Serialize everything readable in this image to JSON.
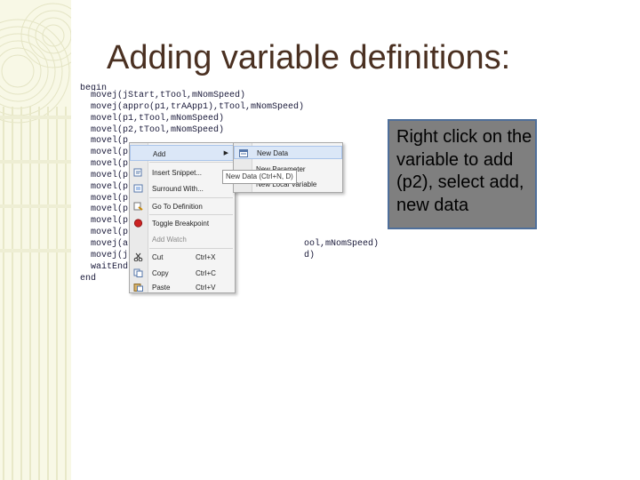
{
  "slide": {
    "title": "Adding variable definitions:",
    "callout_text": "Right click on the variable to add (p2), select add, new data"
  },
  "code": {
    "lines": [
      "begin",
      "  movej(jStart,tTool,mNomSpeed)",
      "  movej(appro(p1,trAApp1),tTool,mNomSpeed)",
      "  movel(p1,tTool,mNomSpeed)",
      "  movel(p2,tTool,mNomSpeed)",
      "  movel(p",
      "  movel(p",
      "  movel(p",
      "  movel(p",
      "  movel(p",
      "  movel(p",
      "  movel(p",
      "  movel(p",
      "  movel(p",
      "  movej(a                                 ool,mNomSpeed)",
      "  movej(j                                 d)",
      "  waitEnd",
      "end"
    ]
  },
  "context_menu": {
    "items": [
      {
        "label": "Add",
        "icon": "none",
        "shortcut": "",
        "submenu": true
      },
      {
        "label": "Insert Snippet...",
        "icon": "snippet-icon",
        "shortcut": ""
      },
      {
        "label": "Surround With...",
        "icon": "surround-icon",
        "shortcut": ""
      },
      {
        "label": "Go To Definition",
        "icon": "goto-definition-icon",
        "shortcut": ""
      },
      {
        "label": "Toggle Breakpoint",
        "icon": "breakpoint-icon",
        "shortcut": ""
      },
      {
        "label": "Add Watch",
        "icon": "none",
        "shortcut": "",
        "disabled": true
      },
      {
        "label": "Cut",
        "icon": "scissors-icon",
        "shortcut": "Ctrl+X"
      },
      {
        "label": "Copy",
        "icon": "copy-icon",
        "shortcut": "Ctrl+C"
      },
      {
        "label": "Paste",
        "icon": "paste-icon",
        "shortcut": "Ctrl+V"
      }
    ],
    "submenu": [
      {
        "label": "New Data",
        "icon": "new-data-icon"
      },
      {
        "label": "New Parameter",
        "icon": "none"
      },
      {
        "label": "New Local Variable",
        "icon": "none"
      }
    ],
    "tooltip": "New Data (Ctrl+N, D)"
  },
  "colors": {
    "title": "#4a3021",
    "callout_bg": "#7f7f7f",
    "callout_border": "#4f6f9a",
    "menu_highlight": "#dbe7f7",
    "breakpoint": "#cc2222"
  }
}
